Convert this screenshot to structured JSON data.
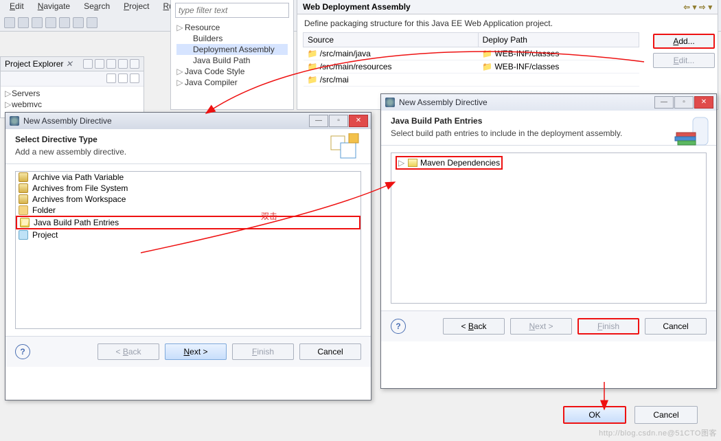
{
  "menu": {
    "edit": "Edit",
    "navigate": "Navigate",
    "search": "Search",
    "project": "Project",
    "run": "Run"
  },
  "explorer": {
    "title": "Project Explorer",
    "close_icon": "✕",
    "items": [
      "Servers",
      "webmvc"
    ]
  },
  "props": {
    "filter_placeholder": "type filter text",
    "nodes": [
      "Resource",
      "Builders",
      "Deployment Assembly",
      "Java Build Path",
      "Java Code Style",
      "Java Compiler"
    ]
  },
  "wda": {
    "title": "Web Deployment Assembly",
    "desc": "Define packaging structure for this Java EE Web Application project.",
    "cols": [
      "Source",
      "Deploy Path"
    ],
    "rows": [
      {
        "s": "/src/main/java",
        "d": "WEB-INF/classes"
      },
      {
        "s": "/src/main/resources",
        "d": "WEB-INF/classes"
      },
      {
        "s": "/src/mai",
        "d": ""
      }
    ],
    "add": "Add...",
    "edit": "Edit..."
  },
  "dlg1": {
    "title": "New Assembly Directive",
    "head": "Select Directive Type",
    "sub": "Add a new assembly directive.",
    "items": [
      {
        "icon": "jar",
        "label": "Archive via Path Variable"
      },
      {
        "icon": "jar",
        "label": "Archives from File System"
      },
      {
        "icon": "jar",
        "label": "Archives from Workspace"
      },
      {
        "icon": "folder",
        "label": "Folder"
      },
      {
        "icon": "jbp",
        "label": "Java Build Path Entries",
        "sel": true
      },
      {
        "icon": "proj",
        "label": "Project"
      }
    ],
    "back": "< Back",
    "next": "Next >",
    "finish": "Finish",
    "cancel": "Cancel"
  },
  "dlg2": {
    "title": "New Assembly Directive",
    "head": "Java Build Path Entries",
    "sub": "Select build path entries to include in the deployment assembly.",
    "node": "Maven Dependencies",
    "back": "< Back",
    "next": "Next >",
    "finish": "Finish",
    "cancel": "Cancel"
  },
  "okbar": {
    "ok": "OK",
    "cancel": "Cancel"
  },
  "annot": {
    "dblclick": "双击"
  },
  "watermark": "http://blog.csdn.ne@51CTO图客"
}
